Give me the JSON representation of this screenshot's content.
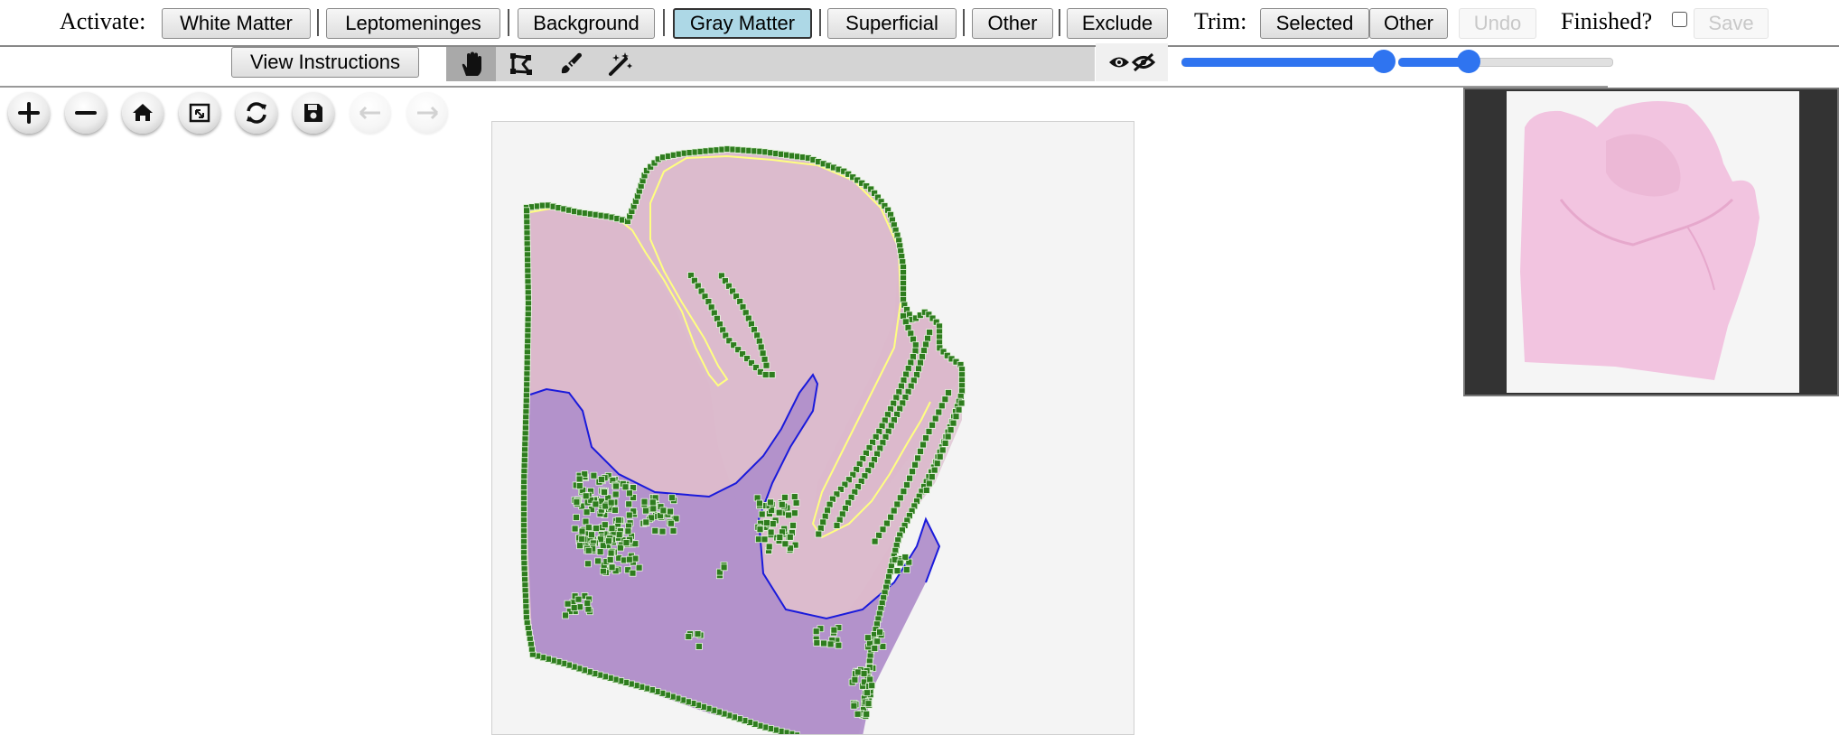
{
  "toolbar": {
    "activate_label": "Activate:",
    "activate_buttons": [
      "White Matter",
      "Leptomeninges",
      "Background",
      "Gray Matter",
      "Superficial",
      "Other",
      "Exclude"
    ],
    "active_button": "Gray Matter",
    "trim_label": "Trim:",
    "trim_selected": "Selected",
    "trim_other": "Other",
    "undo": "Undo",
    "finished_label": "Finished?",
    "finished_checked": false,
    "save": "Save"
  },
  "toolbar2": {
    "view_instructions": "View Instructions",
    "tools": [
      "hand-icon",
      "polygon-icon",
      "brush-icon",
      "magic-wand-icon"
    ],
    "selected_tool": "hand-icon",
    "opacity_slider_1": 0.5,
    "opacity_slider_2": 0.35
  },
  "nav": {
    "buttons": [
      "zoom-in-icon",
      "zoom-out-icon",
      "home-icon",
      "fullscreen-icon",
      "rotate-icon",
      "save-icon",
      "previous-icon",
      "next-icon"
    ],
    "disabled": [
      "previous-icon",
      "next-icon"
    ]
  },
  "colors": {
    "active_button": "#add8e6",
    "slider": "#2f74f0",
    "tissue": "#d9b3c8",
    "white_matter": "#b08fca",
    "gray_matter_outline": "#ffff80",
    "white_matter_outline": "#1a1adb",
    "annotation_points": "#2e7d1e",
    "thumbnail_tissue": "#f2c4e0"
  }
}
